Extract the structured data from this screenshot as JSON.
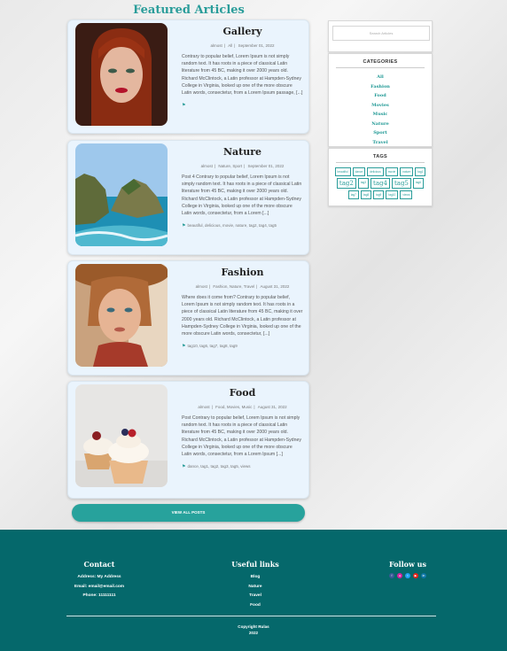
{
  "heading": "Featured Articles",
  "posts": [
    {
      "title": "Gallery",
      "author": "almost",
      "categories": "All",
      "date": "September 01, 2022",
      "excerpt": "Contrary to popular belief, Lorem Ipsum is not simply random text. It has roots in a piece of classical Latin literature from 45 BC, making it over 2000 years old. Richard McClintock, a Latin professor at Hampden-Sydney College in Virginia, looked up one of the more obscure Latin words, consectetur, from a Lorem Ipsum passage, [...]",
      "tags": ""
    },
    {
      "title": "Nature",
      "author": "almost",
      "categories": "Nature, Sport",
      "date": "September 01, 2022",
      "excerpt": "Post 4 Contrary to popular belief, Lorem Ipsum is not simply random text. It has roots in a piece of classical Latin literature from 45 BC, making it over 2000 years old. Richard McClintock, a Latin professor at Hampden-Sydney College in Virginia, looked up one of the more obscure Latin words, consectetur, from a Lorem [...]",
      "tags": "beautiful, delicious, movie, nature, tag2, tag4, tag5"
    },
    {
      "title": "Fashion",
      "author": "almost",
      "categories": "Fashion, Nature, Travel",
      "date": "August 31, 2022",
      "excerpt": "Where does it come from? Contrary to popular belief, Lorem Ipsum is not simply random text. It has roots in a piece of classical Latin literature from 45 BC, making it over 2000 years old. Richard McClintock, a Latin professor at Hampden-Sydney College in Virginia, looked up one of the more obscure Latin words, consectetur, [...]",
      "tags": "tag10, tag6, tag7, tag8, tag9"
    },
    {
      "title": "Food",
      "author": "almost",
      "categories": "Food, Movies, Music",
      "date": "August 31, 2022",
      "excerpt": "Post Contrary to popular belief, Lorem Ipsum is not simply random text. It has roots in a piece of classical Latin literature from 45 BC, making it over 2000 years old. Richard McClintock, a Latin professor at Hampden-Sydney College in Virginia, looked up one of the more obscure Latin words, consectetur, from a Lorem Ipsum [...]",
      "tags": "dance, tag1, tag2, tag3, tag5, views"
    }
  ],
  "view_all": "VIEW ALL POSTS",
  "sidebar": {
    "search_placeholder": "Search Articles",
    "categories_title": "CATEGORIES",
    "categories": [
      "All",
      "Fashion",
      "Food",
      "Movies",
      "Music",
      "Nature",
      "Sport",
      "Travel"
    ],
    "tags_title": "TAGS",
    "tags_row1": [
      "beautiful",
      "dance",
      "delicious",
      "movie",
      "nature",
      "tag1"
    ],
    "tags_row2": [
      "tag2",
      "tag3",
      "tag4",
      "tag5"
    ],
    "tags_row3": [
      "tag6",
      "tag7",
      "tag8",
      "tag9",
      "tag10",
      "views"
    ]
  },
  "footer": {
    "contact_title": "Contact",
    "address": "Address: My Address",
    "email": "Email: email@email.com",
    "phone": "Phone: 11111111",
    "links_title": "Useful links",
    "links": [
      "Blog",
      "Nature",
      "Travel",
      "Food"
    ],
    "follow_title": "Follow us",
    "social": [
      "facebook-icon",
      "instagram-icon",
      "twitter-icon",
      "youtube-icon",
      "linkedin-icon"
    ],
    "copyright": "Copyright Rulas",
    "year": "2022"
  },
  "colors": {
    "accent": "#2a9d9a",
    "footer": "#05686b",
    "card": "#eaf4fd"
  }
}
